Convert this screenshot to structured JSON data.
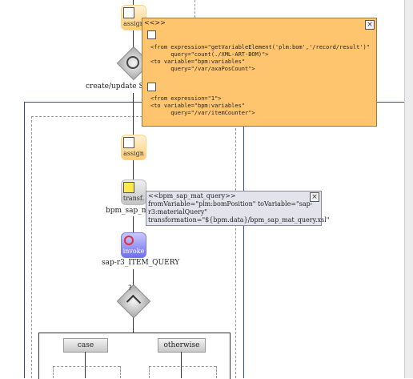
{
  "nodes": {
    "assign_top": {
      "text": "assign"
    },
    "create_update_label": "create/update SAP M",
    "assign_mid": {
      "text": "assign"
    },
    "transf": {
      "text": "transf."
    },
    "bpm_sap_label": "bpm_sap_mat_",
    "invoke": {
      "text": "invoke"
    },
    "invoke_label": "sap-r3_ITEM_QUERY",
    "gateway_symbol": "?"
  },
  "popup_orange": {
    "title": "<<>>",
    "close": "×",
    "code_block_1": "<from expression=\"getVariableElement('plm:bom','/record/result')\"\n      query=\"count(./XML-ART-BOM)\">\n<to variable=\"bpm:variables\"\n      query=\"/var/axaPosCount\">",
    "code_block_2": "<from expression=\"1\">\n<to variable=\"bpm:variables\"\n      query=\"/var/itemCounter\">"
  },
  "popup_gray": {
    "title": "<<bpm_sap_mat_query>>",
    "close": "×",
    "text": "fromVariable=\"plm:bomPosition\" toVariable=\"sap-\nr3:materialQuery\"\ntransformation=\"${bpm.data}/bpm_sap_mat_query.xsl\""
  },
  "switch": {
    "case_label": "case",
    "otherwise_label": "otherwise"
  },
  "colors": {
    "assign": "#ffcc70",
    "invoke": "#6f6ff0",
    "popup_orange": "#ffc56e",
    "popup_gray": "#e3e3ec",
    "accent_line": "#3a4f8a"
  }
}
